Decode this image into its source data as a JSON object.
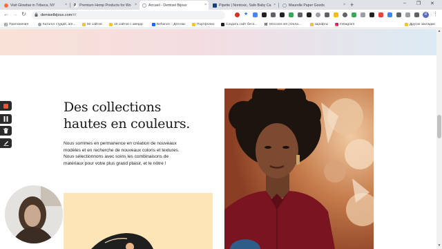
{
  "browser": {
    "tabs": [
      {
        "label": "Visit Glowbar in Tribeca, NY",
        "active": false,
        "favicon_color": "#ff6a3d"
      },
      {
        "label": "Premium Hemp Products for Wo",
        "active": false,
        "favicon_color": "#222222"
      },
      {
        "label": "Accueil - Demisel Bijoux",
        "active": true,
        "favicon_color": "#9aa0a6"
      },
      {
        "label": "Pipette | Nontoxic, Safe Baby Ca",
        "active": false,
        "favicon_color": "#1a3d7c"
      },
      {
        "label": "Maurelle Paper Goods",
        "active": false,
        "favicon_color": "#9aa0a6"
      }
    ],
    "tab_close_glyph": "×",
    "new_tab_glyph": "+",
    "window_controls": [
      "–",
      "❐",
      "✕"
    ],
    "url_host": "demiselbijoux.com",
    "url_path": "/#/",
    "profile_initial": "R",
    "bookmarks": [
      {
        "label": "Приложения",
        "icon": "apps-grid-icon"
      },
      {
        "label": "Каталог студий, аге...",
        "icon": "globe-icon"
      },
      {
        "label": "50 сайтов",
        "icon": "folder-icon"
      },
      {
        "label": "10 сайтов с авердс",
        "icon": "folder-icon"
      },
      {
        "label": "Behance :: Для вас",
        "icon": "behance-icon"
      },
      {
        "label": "Портфолио",
        "icon": "folder-icon"
      },
      {
        "label": "Создать сайт бесп...",
        "icon": "wix-icon"
      },
      {
        "label": "Mocover.net | Онла...",
        "icon": "m-icon"
      },
      {
        "label": "Шрифты",
        "icon": "folder-icon"
      },
      {
        "label": "Instagram",
        "icon": "instagram-icon"
      },
      {
        "label": "Другие закладки",
        "icon": "folder-icon"
      }
    ]
  },
  "page": {
    "headline_line1": "Des collections",
    "headline_line2": "hautes en couleurs.",
    "paragraph": "Nous sommes en permanence en création de nouveaux modèles et en recherche de nouveaux coloris et textures. Nous sélectionnons avec soins les combinaisons de matériaux pour votre plus grand plaisir, et le nôtre !"
  },
  "colors": {
    "hero_gradient_start": "#f8e1d6",
    "hero_gradient_end": "#dbeaf3",
    "illustration_bg": "#fde5b8",
    "record_button": "#e8553b"
  },
  "recorder": {
    "buttons": [
      "record-button",
      "pause-button",
      "delete-button",
      "draw-button"
    ]
  }
}
